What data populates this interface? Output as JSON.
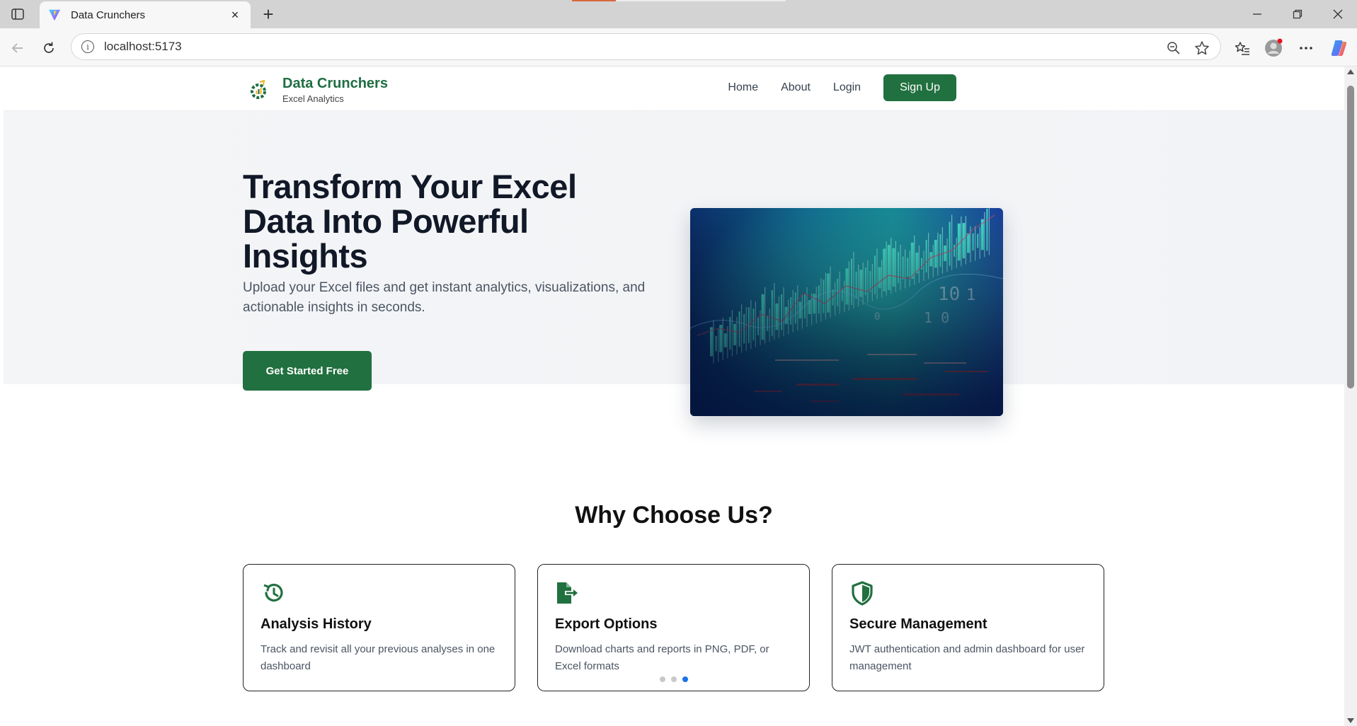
{
  "browser": {
    "tab_title": "Data Crunchers",
    "url": "localhost:5173",
    "tab_close": "×",
    "new_tab": "+"
  },
  "site": {
    "brand_name": "Data Crunchers",
    "brand_sub": "Excel Analytics",
    "nav": {
      "home": "Home",
      "about": "About",
      "login": "Login",
      "signup": "Sign Up"
    }
  },
  "hero": {
    "title": "Transform Your Excel Data Into Powerful Insights",
    "subtitle": "Upload your Excel files and get instant analytics, visualizations, and actionable insights in seconds.",
    "cta": "Get Started Free"
  },
  "features": {
    "heading": "Why Choose Us?",
    "cards": [
      {
        "icon": "history-icon",
        "title": "Analysis History",
        "desc": "Track and revisit all your previous analyses in one dashboard"
      },
      {
        "icon": "file-export-icon",
        "title": "Export Options",
        "desc": "Download charts and reports in PNG, PDF, or Excel formats"
      },
      {
        "icon": "shield-icon",
        "title": "Secure Management",
        "desc": "JWT authentication and admin dashboard for user management"
      }
    ],
    "carousel_active_index": 2
  },
  "colors": {
    "brand_green": "#21703f",
    "carousel_active": "#1a73e8"
  }
}
